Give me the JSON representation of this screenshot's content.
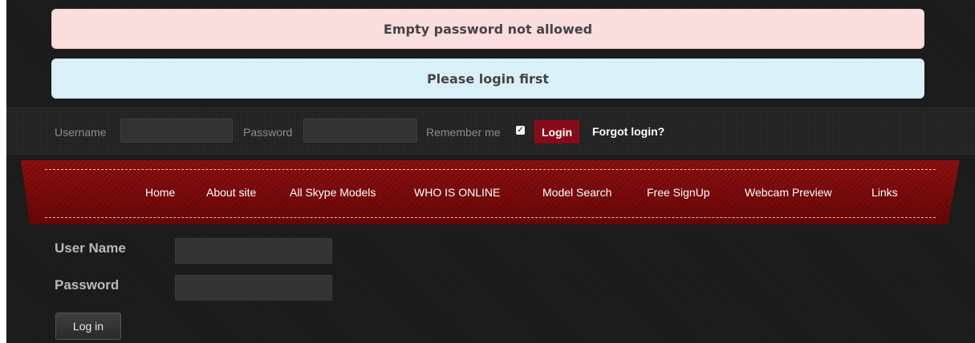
{
  "alerts": {
    "error": "Empty password not allowed",
    "info": "Please login first"
  },
  "login_bar": {
    "username_label": "Username",
    "password_label": "Password",
    "remember_label": "Remember me",
    "remember_checked": true,
    "login_button": "Login",
    "forgot_link": "Forgot login?"
  },
  "nav": {
    "items": [
      "Home",
      "About site",
      "All Skype Models",
      "WHO IS ONLINE",
      "Model Search",
      "Free SignUp",
      "Webcam Preview",
      "Links"
    ]
  },
  "login_form": {
    "username_label": "User Name",
    "password_label": "Password",
    "submit_label": "Log in"
  },
  "colors": {
    "ribbon": "#7d0a0a",
    "error_bg": "#fadddd",
    "info_bg": "#daf0f8",
    "login_button_bg": "#8b0a1a"
  }
}
